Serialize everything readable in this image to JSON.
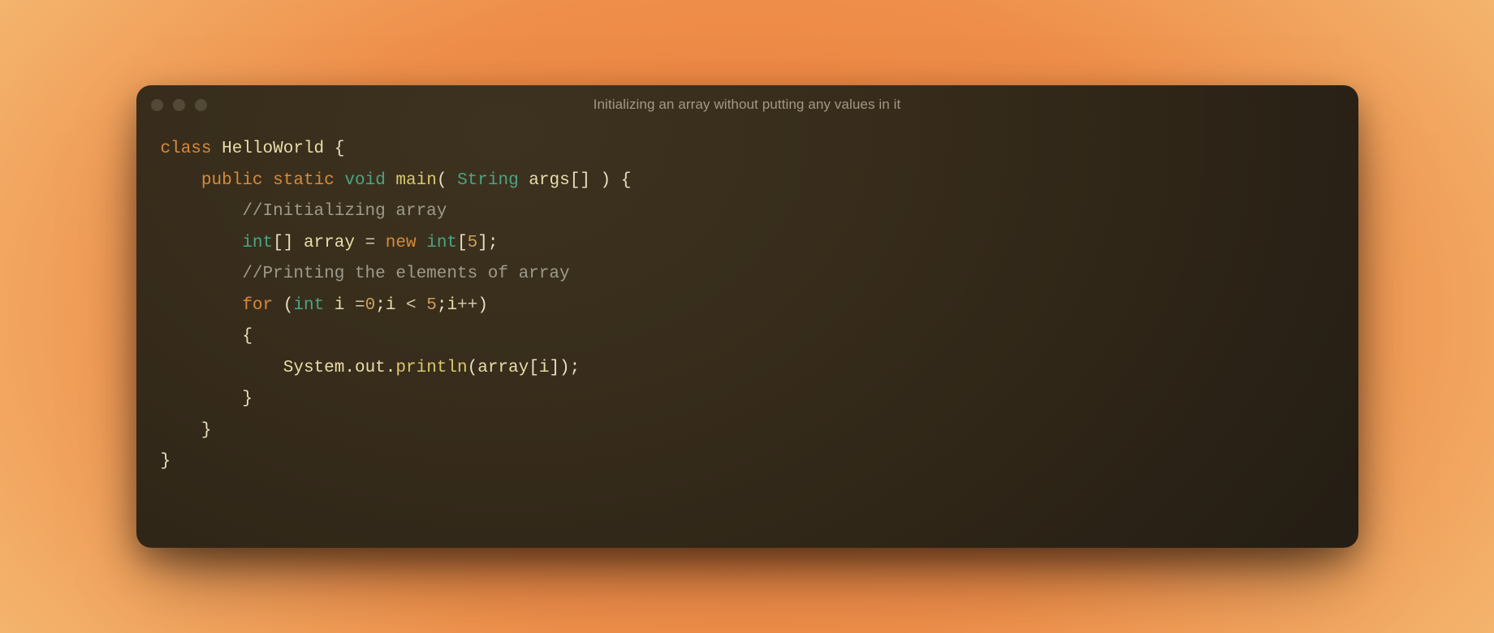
{
  "window": {
    "title": "Initializing an array without putting any values in it"
  },
  "colors": {
    "bg_start": "#e97a3a",
    "bg_end": "#f8cc89",
    "window_bg": "#352b1a",
    "traffic_dot": "#6a614f",
    "title_text": "#b7aa94",
    "tok_kw": "#d78a3a",
    "tok_type": "#4aa585",
    "tok_fn": "#d9c86a",
    "tok_comm": "#9e9a8c",
    "tok_id": "#e9dea8",
    "tok_num": "#caa05a"
  },
  "code": {
    "lines": [
      [
        {
          "t": "class",
          "c": "kw"
        },
        {
          "t": " ",
          "c": "punc"
        },
        {
          "t": "HelloWorld",
          "c": "id"
        },
        {
          "t": " {",
          "c": "punc"
        }
      ],
      [
        {
          "t": "    ",
          "c": "punc"
        },
        {
          "t": "public",
          "c": "kw"
        },
        {
          "t": " ",
          "c": "punc"
        },
        {
          "t": "static",
          "c": "kw"
        },
        {
          "t": " ",
          "c": "punc"
        },
        {
          "t": "void",
          "c": "type"
        },
        {
          "t": " ",
          "c": "punc"
        },
        {
          "t": "main",
          "c": "fn"
        },
        {
          "t": "( ",
          "c": "punc"
        },
        {
          "t": "String",
          "c": "type"
        },
        {
          "t": " ",
          "c": "punc"
        },
        {
          "t": "args",
          "c": "id"
        },
        {
          "t": "[] ) {",
          "c": "punc"
        }
      ],
      [
        {
          "t": "        ",
          "c": "punc"
        },
        {
          "t": "//Initializing array",
          "c": "comm"
        }
      ],
      [
        {
          "t": "        ",
          "c": "punc"
        },
        {
          "t": "int",
          "c": "type"
        },
        {
          "t": "[] ",
          "c": "punc"
        },
        {
          "t": "array",
          "c": "id"
        },
        {
          "t": " ",
          "c": "punc"
        },
        {
          "t": "=",
          "c": "op"
        },
        {
          "t": " ",
          "c": "punc"
        },
        {
          "t": "new",
          "c": "kw"
        },
        {
          "t": " ",
          "c": "punc"
        },
        {
          "t": "int",
          "c": "type"
        },
        {
          "t": "[",
          "c": "punc"
        },
        {
          "t": "5",
          "c": "num"
        },
        {
          "t": "];",
          "c": "punc"
        }
      ],
      [
        {
          "t": "        ",
          "c": "punc"
        },
        {
          "t": "//Printing the elements of array",
          "c": "comm"
        }
      ],
      [
        {
          "t": "        ",
          "c": "punc"
        },
        {
          "t": "for",
          "c": "kw"
        },
        {
          "t": " (",
          "c": "punc"
        },
        {
          "t": "int",
          "c": "type"
        },
        {
          "t": " ",
          "c": "punc"
        },
        {
          "t": "i",
          "c": "id"
        },
        {
          "t": " ",
          "c": "punc"
        },
        {
          "t": "=",
          "c": "op"
        },
        {
          "t": "0",
          "c": "num"
        },
        {
          "t": ";",
          "c": "punc"
        },
        {
          "t": "i",
          "c": "id"
        },
        {
          "t": " ",
          "c": "punc"
        },
        {
          "t": "<",
          "c": "op"
        },
        {
          "t": " ",
          "c": "punc"
        },
        {
          "t": "5",
          "c": "num"
        },
        {
          "t": ";",
          "c": "punc"
        },
        {
          "t": "i",
          "c": "id"
        },
        {
          "t": "++",
          "c": "op"
        },
        {
          "t": ")",
          "c": "punc"
        }
      ],
      [
        {
          "t": "        {",
          "c": "punc"
        }
      ],
      [
        {
          "t": "            ",
          "c": "punc"
        },
        {
          "t": "System",
          "c": "id"
        },
        {
          "t": ".",
          "c": "punc"
        },
        {
          "t": "out",
          "c": "id"
        },
        {
          "t": ".",
          "c": "punc"
        },
        {
          "t": "println",
          "c": "fn"
        },
        {
          "t": "(",
          "c": "punc"
        },
        {
          "t": "array",
          "c": "id"
        },
        {
          "t": "[",
          "c": "punc"
        },
        {
          "t": "i",
          "c": "id"
        },
        {
          "t": "]);",
          "c": "punc"
        }
      ],
      [
        {
          "t": "        }",
          "c": "punc"
        }
      ],
      [
        {
          "t": "    }",
          "c": "punc"
        }
      ],
      [
        {
          "t": "}",
          "c": "punc"
        }
      ]
    ]
  }
}
